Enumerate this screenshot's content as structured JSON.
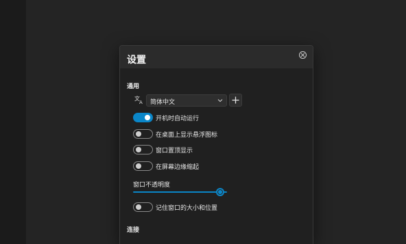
{
  "dialog": {
    "title": "设置",
    "close_icon": "close-circle-icon"
  },
  "general": {
    "section_title": "通用",
    "language_icon": "translate-icon",
    "language_value": "简体中文",
    "add_icon": "plus-icon",
    "toggles": [
      {
        "label": "开机时自动运行",
        "on": true
      },
      {
        "label": "在桌面上显示悬浮图标",
        "on": false
      },
      {
        "label": "窗口置顶显示",
        "on": false
      },
      {
        "label": "在屏幕边缘缩起",
        "on": false
      }
    ],
    "opacity_label": "窗口不透明度",
    "opacity_value": 0.97,
    "remember_toggle": {
      "label": "记住窗口的大小和位置",
      "on": false
    }
  },
  "connection": {
    "section_title": "连接"
  },
  "colors": {
    "accent": "#0a86c8",
    "dialog_bg": "#202020",
    "header_bg": "#2b2b2b"
  }
}
